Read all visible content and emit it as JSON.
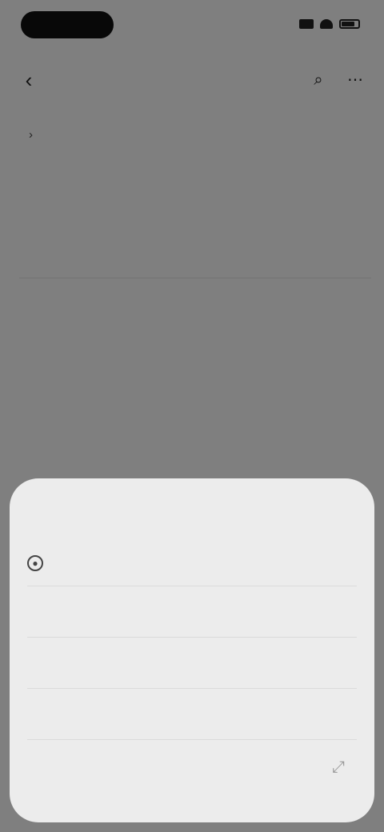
{
  "status_bar": {
    "time": "",
    "icons": [
      "signal-icon",
      "wifi-icon",
      "battery-icon"
    ]
  },
  "nav": {
    "back_icon": "back-icon",
    "actions": [
      "search-icon",
      "more-icon"
    ]
  },
  "breadcrumb": {
    "items": [
      "",
      ""
    ]
  },
  "page": {
    "title": "",
    "subtitle": ""
  },
  "meta": {
    "left": "",
    "right": ""
  },
  "section": {
    "title": "",
    "link": ""
  },
  "paragraphs": [
    "",
    ""
  ],
  "sheet": {
    "title": "",
    "items": [
      {
        "label": "",
        "value": "",
        "icon": "radio-icon"
      },
      {
        "label": "",
        "value": ""
      },
      {
        "label": "",
        "value": ""
      },
      {
        "label": "",
        "value": ""
      }
    ],
    "corner_icon": "expand-icon"
  },
  "colors": {
    "scrim": "#000000",
    "sheet_background": "#ececec",
    "page_background": "#f4f4f4"
  }
}
